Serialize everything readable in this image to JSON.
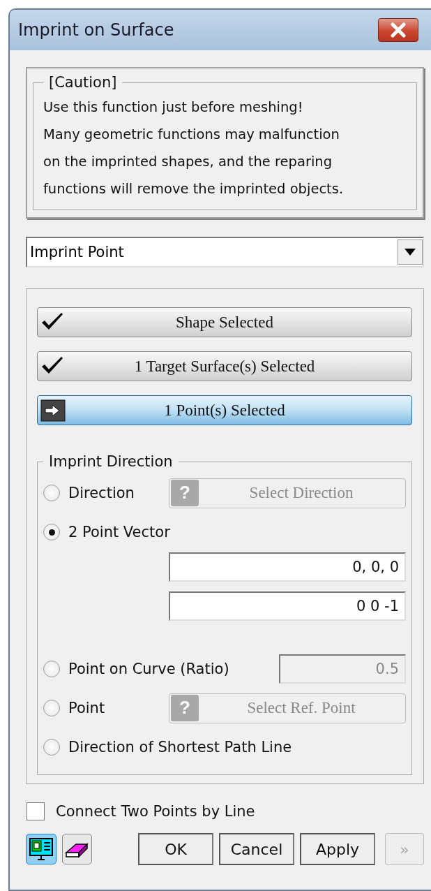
{
  "window": {
    "title": "Imprint on Surface"
  },
  "caution": {
    "title": "[Caution]",
    "lines": [
      "Use this function just before meshing!",
      "Many geometric functions may malfunction",
      "on the imprinted shapes, and the reparing",
      "functions will remove the imprinted objects."
    ]
  },
  "mode_dropdown": {
    "value": "Imprint Point"
  },
  "selection_steps": [
    {
      "label": "Shape Selected",
      "kind": "done"
    },
    {
      "label": "1 Target Surface(s) Selected",
      "kind": "done"
    },
    {
      "label": "1 Point(s) Selected",
      "kind": "active"
    }
  ],
  "direction_group": {
    "title": "Imprint Direction",
    "options": [
      {
        "label": "Direction",
        "selected": false,
        "kind": "button",
        "button": {
          "icon": "?",
          "label": "Select Direction",
          "disabled": true
        }
      },
      {
        "label": "2 Point Vector",
        "selected": true,
        "kind": "fields",
        "fields": [
          {
            "value": "0, 0, 0"
          },
          {
            "value": "0 0 -1"
          }
        ]
      },
      {
        "label": "Point on Curve (Ratio)",
        "selected": false,
        "kind": "field",
        "field": {
          "value": "0.5",
          "disabled": true
        }
      },
      {
        "label": "Point",
        "selected": false,
        "kind": "button",
        "button": {
          "icon": "?",
          "label": "Select Ref. Point",
          "disabled": true
        }
      },
      {
        "label": "Direction of Shortest Path Line",
        "selected": false,
        "kind": "plain"
      }
    ]
  },
  "connect_checkbox": {
    "label": "Connect Two Points by Line",
    "checked": false
  },
  "footer_buttons": [
    {
      "label": "OK",
      "disabled": false
    },
    {
      "label": "Cancel",
      "disabled": false
    },
    {
      "label": "Apply",
      "disabled": false
    },
    {
      "label": "»",
      "disabled": true
    }
  ]
}
